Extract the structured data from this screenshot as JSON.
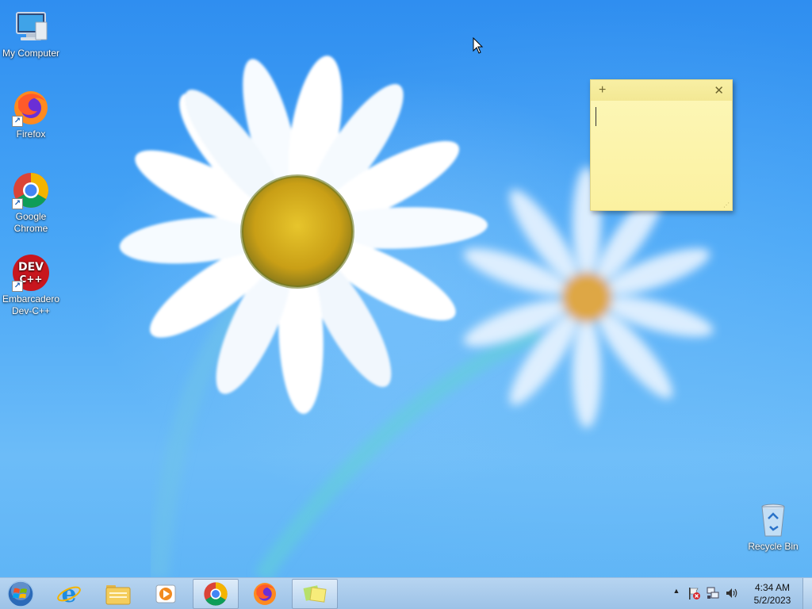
{
  "desktop": {
    "icons": [
      {
        "label": "My Computer",
        "icon": "computer-icon"
      },
      {
        "label": "Firefox",
        "icon": "firefox-icon"
      },
      {
        "label": "Google Chrome",
        "icon": "chrome-icon"
      },
      {
        "label": "Embarcadero Dev-C++",
        "icon": "devcpp-icon",
        "badge_text": "DEV",
        "badge_sub": "C++"
      },
      {
        "label": "Recycle Bin",
        "icon": "recycle-bin-icon"
      }
    ]
  },
  "sticky_note": {
    "add_symbol": "+",
    "close_symbol": "✕",
    "text": ""
  },
  "taskbar": {
    "start": {
      "icon": "windows-orb-icon"
    },
    "pinned": [
      {
        "name": "Internet Explorer",
        "icon": "ie-icon",
        "active": false
      },
      {
        "name": "File Explorer",
        "icon": "folder-icon",
        "active": false
      },
      {
        "name": "Windows Media Player",
        "icon": "media-player-icon",
        "active": false
      },
      {
        "name": "Google Chrome",
        "icon": "chrome-icon",
        "active": true
      },
      {
        "name": "Firefox",
        "icon": "firefox-icon",
        "active": false
      },
      {
        "name": "Sticky Notes",
        "icon": "sticky-notes-icon",
        "active": true
      }
    ],
    "tray": {
      "overflow_symbol": "▲",
      "time": "4:34 AM",
      "date": "5/2/2023"
    }
  },
  "colors": {
    "sticky_yellow": "#fdf7b8",
    "taskbar": "#b8d3ee",
    "accent_blue": "#2f8ef0"
  }
}
